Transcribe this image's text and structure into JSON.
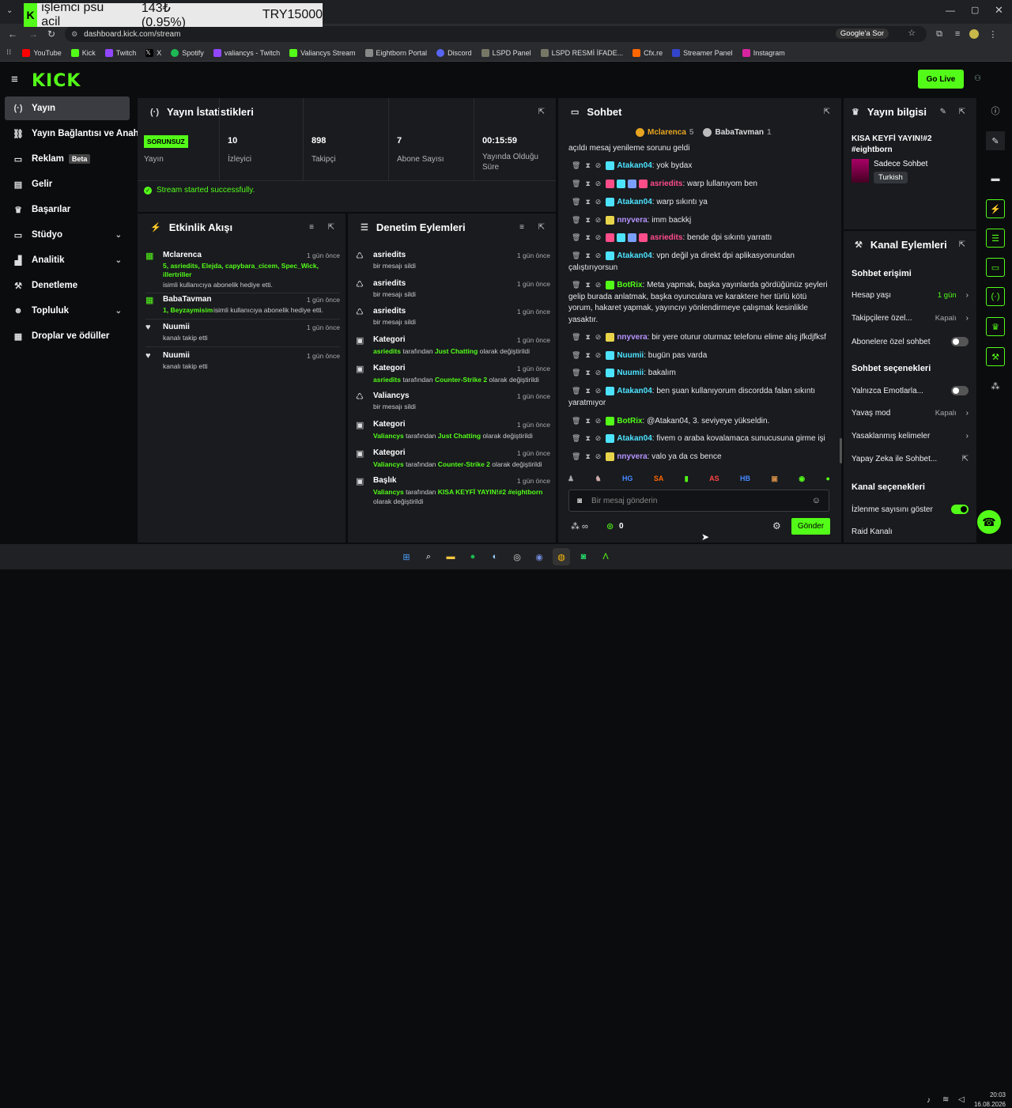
{
  "overlay": {
    "t1": "işlemci psu acil",
    "t2": "143₺ (0.95%)",
    "t3": "TRY15000"
  },
  "browser": {
    "url": "dashboard.kick.com/stream",
    "google": "Google'a Sor"
  },
  "bookmarks": [
    "YouTube",
    "Kick",
    "Twitch",
    "X",
    "Spotify",
    "valiancys - Twitch",
    "Valiancys Stream",
    "Eightborn Portal",
    "Discord",
    "LSPD Panel",
    "LSPD  RESMİ İFADE...",
    "Cfx.re",
    "Streamer Panel",
    "Instagram"
  ],
  "header": {
    "logo": "KICK",
    "golive": "Go Live"
  },
  "sidebar": [
    {
      "label": "Yayın",
      "icon": "(·)"
    },
    {
      "label": "Yayın Bağlantısı ve Anahtarı",
      "icon": "⛓"
    },
    {
      "label": "Reklam",
      "icon": "▭",
      "badge": "Beta"
    },
    {
      "label": "Gelir",
      "icon": "▤"
    },
    {
      "label": "Başarılar",
      "icon": "🏆"
    },
    {
      "label": "Stüdyo",
      "icon": "▭",
      "chev": "⌄"
    },
    {
      "label": "Analitik",
      "icon": "▟",
      "chev": "⌄"
    },
    {
      "label": "Denetleme",
      "icon": "🔨"
    },
    {
      "label": "Topluluk",
      "icon": "👥",
      "chev": "⌄"
    },
    {
      "label": "Droplar ve ödüller",
      "icon": "🎁"
    }
  ],
  "stats": {
    "title": "Yayın İstatistikleri",
    "status": "SORUNSUZ",
    "status_label": "Yayın",
    "items": [
      {
        "v": "10",
        "l": "İzleyici"
      },
      {
        "v": "898",
        "l": "Takipçi"
      },
      {
        "v": "7",
        "l": "Abone Sayısı"
      },
      {
        "v": "00:15:59",
        "l": "Yayında Olduğu Süre"
      }
    ],
    "success": "Stream started successfully."
  },
  "activity": {
    "title": "Etkinlik Akışı",
    "rows": [
      {
        "name": "Mclarenca",
        "time": "1 gün önce",
        "d1": "5, asriedits, Elejda, capybara_cicem, Spec_Wick, illertriller",
        "d2": "isimli kullanıcıya abonelik hediye etti."
      },
      {
        "name": "BabaTavman",
        "time": "1 gün önce",
        "d1": "1, Beyzaymisim",
        "d2": "isimli kullanıcıya abonelik hediye etti."
      },
      {
        "name": "Nuumii",
        "time": "1 gün önce",
        "d1": "",
        "d2": "kanalı takip etti"
      },
      {
        "name": "Nuumii",
        "time": "1 gün önce",
        "d1": "",
        "d2": "kanalı takip etti"
      }
    ]
  },
  "moderation": {
    "title": "Denetim Eylemleri",
    "rows": [
      {
        "name": "asriedits",
        "time": "1 gün önce",
        "d": "bir mesajı sildi"
      },
      {
        "name": "asriedits",
        "time": "1 gün önce",
        "d": "bir mesajı sildi"
      },
      {
        "name": "asriedits",
        "time": "1 gün önce",
        "d": "bir mesajı sildi"
      },
      {
        "name": "Kategori",
        "time": "1 gün önce",
        "who": "asriedits",
        "mid": " tarafından ",
        "what": "Just Chatting",
        "tail": " olarak değiştirildi"
      },
      {
        "name": "Kategori",
        "time": "1 gün önce",
        "who": "asriedits",
        "mid": " tarafından ",
        "what": "Counter-Strike 2",
        "tail": " olarak değiştirildi"
      },
      {
        "name": "Valiancys",
        "time": "1 gün önce",
        "d": "bir mesajı sildi"
      },
      {
        "name": "Kategori",
        "time": "1 gün önce",
        "who": "Valiancys",
        "mid": " tarafından ",
        "what": "Just Chatting",
        "tail": " olarak değiştirildi"
      },
      {
        "name": "Kategori",
        "time": "1 gün önce",
        "who": "Valiancys",
        "mid": " tarafından ",
        "what": "Counter-Strike 2",
        "tail": " olarak değiştirildi"
      },
      {
        "name": "Başlık",
        "time": "1 gün önce",
        "who": "Valiancys",
        "mid": " tarafından ",
        "what": "KISA KEYFİ YAYIN!#2 #eightborn",
        "tail": " olarak değiştirildi"
      }
    ]
  },
  "chat": {
    "title": "Sohbet",
    "top1": "Mclarenca",
    "top1n": "5",
    "top2": "BabaTavman",
    "top2n": "1",
    "first": "açıldı mesaj yenileme sorunu geldi",
    "messages": [
      {
        "u": "Atakan04",
        "c": "u4",
        "m": ": yok bydax"
      },
      {
        "u": "asriedits",
        "c": "u3",
        "m": ": warp lullanıyom ben"
      },
      {
        "u": "Atakan04",
        "c": "u4",
        "m": ": warp sıkıntı ya"
      },
      {
        "u": "nnyvera",
        "c": "u2",
        "m": ": imm backkj"
      },
      {
        "u": "asriedits",
        "c": "u3",
        "m": ": bende dpi sıkıntı yarrattı"
      },
      {
        "u": "Atakan04",
        "c": "u4",
        "m": ": vpn değil ya direkt dpi aplikasyonundan çalıştırıyorsun"
      },
      {
        "u": "BotRix",
        "c": "u1",
        "m": ": Meta yapmak, başka yayınlarda gördüğünüz şeyleri gelip burada anlatmak, başka oyunculara ve karaktere her türlü kötü yorum, hakaret yapmak, yayıncıyı yönlendirmeye çalışmak kesinlikle yasaktır."
      },
      {
        "u": "nnyvera",
        "c": "u2",
        "m": ": bir yere oturur oturmaz telefonu elime alış jfkdjfksf"
      },
      {
        "u": "Nuumii",
        "c": "u4",
        "m": ": bugün pas varda"
      },
      {
        "u": "Nuumii",
        "c": "u4",
        "m": ": bakalım"
      },
      {
        "u": "Atakan04",
        "c": "u4",
        "m": ": ben şuan kullanıyorum discordda falan sıkıntı yaratmıyor"
      },
      {
        "u": "BotRix",
        "c": "u1",
        "m": ": @Atakan04, 3. seviyeye yükseldin."
      },
      {
        "u": "Atakan04",
        "c": "u4",
        "m": ": fivem o araba kovalamaca sunucusuna girme işi"
      },
      {
        "u": "nnyvera",
        "c": "u2",
        "m": ": valo ya da cs bence"
      }
    ],
    "placeholder": "Bir mesaj gönderin",
    "points": "0",
    "send": "Gönder"
  },
  "info": {
    "title": "Yayın bilgisi",
    "stream_title": "KISA KEYFİ YAYIN!#2 #eightborn",
    "category": "Sadece Sohbet",
    "lang": "Turkish"
  },
  "channel": {
    "title": "Kanal Eylemleri",
    "s1": "Sohbet erişimi",
    "r1": "Hesap yaşı",
    "r1v": "1 gün",
    "r2": "Takipçilere özel...",
    "r2v": "Kapalı",
    "r3": "Abonelere özel sohbet",
    "s2": "Sohbet seçenekleri",
    "r4": "Yalnızca Emotlarla...",
    "r5": "Yavaş mod",
    "r5v": "Kapalı",
    "r6": "Yasaklanmış kelimeler",
    "r7": "Yapay Zeka ile Sohbet...",
    "s3": "Kanal seçenekleri",
    "r8": "İzlenme sayısını göster",
    "r9": "Raid Kanalı"
  },
  "clock": {
    "time": "20:03",
    "date": "16.08.2026"
  },
  "colors": {
    "accent": "#53fc18"
  }
}
